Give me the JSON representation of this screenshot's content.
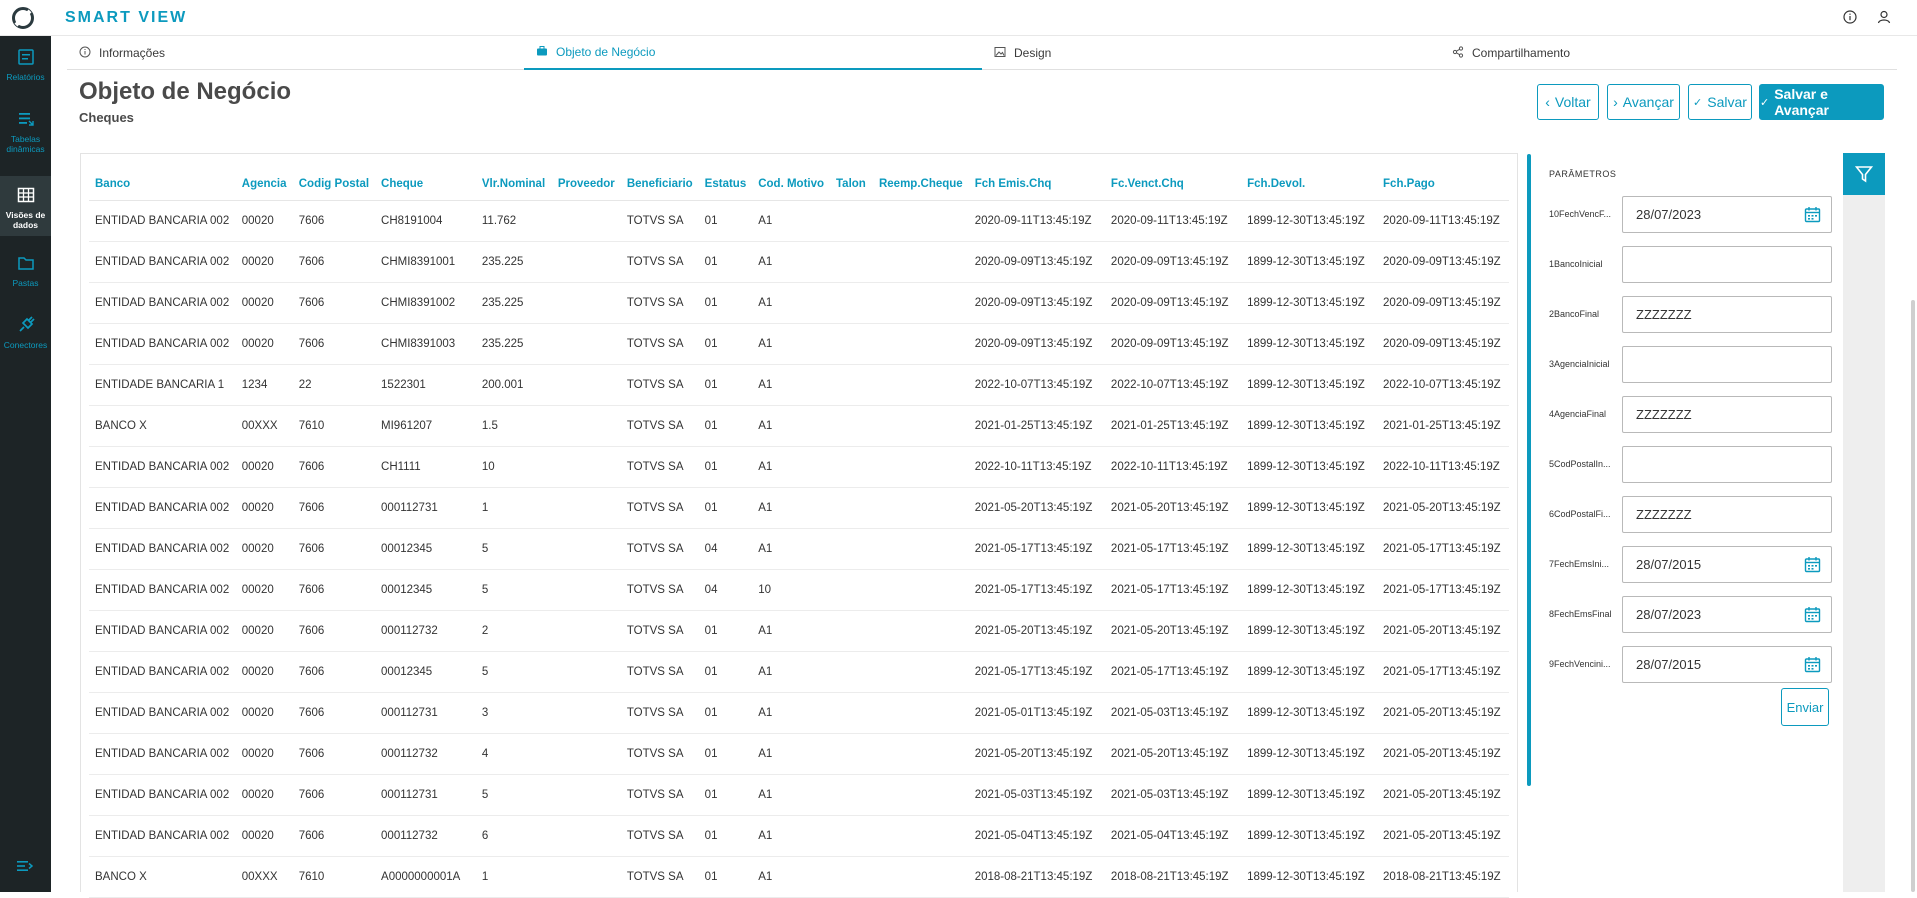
{
  "app": {
    "title": "SMART VIEW"
  },
  "sidebar": {
    "items": [
      {
        "label": "Relatórios",
        "icon": "report-icon"
      },
      {
        "label": "Tabelas dinâmicas",
        "icon": "pivot-table-icon"
      },
      {
        "label": "Visões de dados",
        "icon": "grid-icon"
      },
      {
        "label": "Pastas",
        "icon": "folder-icon"
      },
      {
        "label": "Conectores",
        "icon": "plug-icon"
      }
    ]
  },
  "tabs": [
    {
      "label": "Informações",
      "icon": "info-icon"
    },
    {
      "label": "Objeto de Negócio",
      "icon": "briefcase-icon"
    },
    {
      "label": "Design",
      "icon": "image-icon"
    },
    {
      "label": "Compartilhamento",
      "icon": "share-icon"
    }
  ],
  "header": {
    "title": "Objeto de Negócio",
    "subtitle": "Cheques"
  },
  "actions": {
    "back": "Voltar",
    "next": "Avançar",
    "save": "Salvar",
    "save_next": "Salvar e Avançar"
  },
  "table": {
    "columns": [
      "Banco",
      "Agencia",
      "Codig Postal",
      "Cheque",
      "Vlr.Nominal",
      "Proveedor",
      "Beneficiario",
      "Estatus",
      "Cod. Motivo",
      "Talon",
      "Reemp.Cheque",
      "Fch Emis.Chq",
      "Fc.Venct.Chq",
      "Fch.Devol.",
      "Fch.Pago"
    ],
    "rows": [
      [
        "ENTIDAD BANCARIA 002",
        "00020",
        "7606",
        "CH8191004",
        "11.762",
        "",
        "TOTVS SA",
        "01",
        "A1",
        "",
        "",
        "2020-09-11T13:45:19Z",
        "2020-09-11T13:45:19Z",
        "1899-12-30T13:45:19Z",
        "2020-09-11T13:45:19Z"
      ],
      [
        "ENTIDAD BANCARIA 002",
        "00020",
        "7606",
        "CHMI8391001",
        "235.225",
        "",
        "TOTVS SA",
        "01",
        "A1",
        "",
        "",
        "2020-09-09T13:45:19Z",
        "2020-09-09T13:45:19Z",
        "1899-12-30T13:45:19Z",
        "2020-09-09T13:45:19Z"
      ],
      [
        "ENTIDAD BANCARIA 002",
        "00020",
        "7606",
        "CHMI8391002",
        "235.225",
        "",
        "TOTVS SA",
        "01",
        "A1",
        "",
        "",
        "2020-09-09T13:45:19Z",
        "2020-09-09T13:45:19Z",
        "1899-12-30T13:45:19Z",
        "2020-09-09T13:45:19Z"
      ],
      [
        "ENTIDAD BANCARIA 002",
        "00020",
        "7606",
        "CHMI8391003",
        "235.225",
        "",
        "TOTVS SA",
        "01",
        "A1",
        "",
        "",
        "2020-09-09T13:45:19Z",
        "2020-09-09T13:45:19Z",
        "1899-12-30T13:45:19Z",
        "2020-09-09T13:45:19Z"
      ],
      [
        "ENTIDADE BANCARIA 1",
        "1234",
        "22",
        "1522301",
        "200.001",
        "",
        "TOTVS SA",
        "01",
        "A1",
        "",
        "",
        "2022-10-07T13:45:19Z",
        "2022-10-07T13:45:19Z",
        "1899-12-30T13:45:19Z",
        "2022-10-07T13:45:19Z"
      ],
      [
        "BANCO X",
        "00XXX",
        "7610",
        "MI961207",
        "1.5",
        "",
        "TOTVS SA",
        "01",
        "A1",
        "",
        "",
        "2021-01-25T13:45:19Z",
        "2021-01-25T13:45:19Z",
        "1899-12-30T13:45:19Z",
        "2021-01-25T13:45:19Z"
      ],
      [
        "ENTIDAD BANCARIA 002",
        "00020",
        "7606",
        "CH1111",
        "10",
        "",
        "TOTVS SA",
        "01",
        "A1",
        "",
        "",
        "2022-10-11T13:45:19Z",
        "2022-10-11T13:45:19Z",
        "1899-12-30T13:45:19Z",
        "2022-10-11T13:45:19Z"
      ],
      [
        "ENTIDAD BANCARIA 002",
        "00020",
        "7606",
        "000112731",
        "1",
        "",
        "TOTVS SA",
        "01",
        "A1",
        "",
        "",
        "2021-05-20T13:45:19Z",
        "2021-05-20T13:45:19Z",
        "1899-12-30T13:45:19Z",
        "2021-05-20T13:45:19Z"
      ],
      [
        "ENTIDAD BANCARIA 002",
        "00020",
        "7606",
        "00012345",
        "5",
        "",
        "TOTVS SA",
        "04",
        "A1",
        "",
        "",
        "2021-05-17T13:45:19Z",
        "2021-05-17T13:45:19Z",
        "1899-12-30T13:45:19Z",
        "2021-05-17T13:45:19Z"
      ],
      [
        "ENTIDAD BANCARIA 002",
        "00020",
        "7606",
        "00012345",
        "5",
        "",
        "TOTVS SA",
        "04",
        "10",
        "",
        "",
        "2021-05-17T13:45:19Z",
        "2021-05-17T13:45:19Z",
        "1899-12-30T13:45:19Z",
        "2021-05-17T13:45:19Z"
      ],
      [
        "ENTIDAD BANCARIA 002",
        "00020",
        "7606",
        "000112732",
        "2",
        "",
        "TOTVS SA",
        "01",
        "A1",
        "",
        "",
        "2021-05-20T13:45:19Z",
        "2021-05-20T13:45:19Z",
        "1899-12-30T13:45:19Z",
        "2021-05-20T13:45:19Z"
      ],
      [
        "ENTIDAD BANCARIA 002",
        "00020",
        "7606",
        "00012345",
        "5",
        "",
        "TOTVS SA",
        "01",
        "A1",
        "",
        "",
        "2021-05-17T13:45:19Z",
        "2021-05-17T13:45:19Z",
        "1899-12-30T13:45:19Z",
        "2021-05-17T13:45:19Z"
      ],
      [
        "ENTIDAD BANCARIA 002",
        "00020",
        "7606",
        "000112731",
        "3",
        "",
        "TOTVS SA",
        "01",
        "A1",
        "",
        "",
        "2021-05-01T13:45:19Z",
        "2021-05-03T13:45:19Z",
        "1899-12-30T13:45:19Z",
        "2021-05-20T13:45:19Z"
      ],
      [
        "ENTIDAD BANCARIA 002",
        "00020",
        "7606",
        "000112732",
        "4",
        "",
        "TOTVS SA",
        "01",
        "A1",
        "",
        "",
        "2021-05-20T13:45:19Z",
        "2021-05-20T13:45:19Z",
        "1899-12-30T13:45:19Z",
        "2021-05-20T13:45:19Z"
      ],
      [
        "ENTIDAD BANCARIA 002",
        "00020",
        "7606",
        "000112731",
        "5",
        "",
        "TOTVS SA",
        "01",
        "A1",
        "",
        "",
        "2021-05-03T13:45:19Z",
        "2021-05-03T13:45:19Z",
        "1899-12-30T13:45:19Z",
        "2021-05-20T13:45:19Z"
      ],
      [
        "ENTIDAD BANCARIA 002",
        "00020",
        "7606",
        "000112732",
        "6",
        "",
        "TOTVS SA",
        "01",
        "A1",
        "",
        "",
        "2021-05-04T13:45:19Z",
        "2021-05-04T13:45:19Z",
        "1899-12-30T13:45:19Z",
        "2021-05-20T13:45:19Z"
      ],
      [
        "BANCO X",
        "00XXX",
        "7610",
        "A0000000001A",
        "1",
        "",
        "TOTVS SA",
        "01",
        "A1",
        "",
        "",
        "2018-08-21T13:45:19Z",
        "2018-08-21T13:45:19Z",
        "1899-12-30T13:45:19Z",
        "2018-08-21T13:45:19Z"
      ]
    ]
  },
  "params": {
    "title": "PARÂMETROS",
    "items": [
      {
        "label": "10FechVencF...",
        "value": "28/07/2023",
        "calendar": true
      },
      {
        "label": "1BancoInicial",
        "value": "",
        "calendar": false
      },
      {
        "label": "2BancoFinal",
        "value": "ZZZZZZZ",
        "calendar": false
      },
      {
        "label": "3AgenciaInicial",
        "value": "",
        "calendar": false
      },
      {
        "label": "4AgenciaFinal",
        "value": "ZZZZZZZ",
        "calendar": false
      },
      {
        "label": "5CodPostalIn...",
        "value": "",
        "calendar": false
      },
      {
        "label": "6CodPostalFi...",
        "value": "ZZZZZZZ",
        "calendar": false
      },
      {
        "label": "7FechEmsIni...",
        "value": "28/07/2015",
        "calendar": true
      },
      {
        "label": "8FechEmsFinal",
        "value": "28/07/2023",
        "calendar": true
      },
      {
        "label": "9FechVencini...",
        "value": "28/07/2015",
        "calendar": true
      }
    ],
    "send_label": "Enviar"
  },
  "colors": {
    "accent": "#0c9abe",
    "sidebar_bg": "#1d2426"
  }
}
